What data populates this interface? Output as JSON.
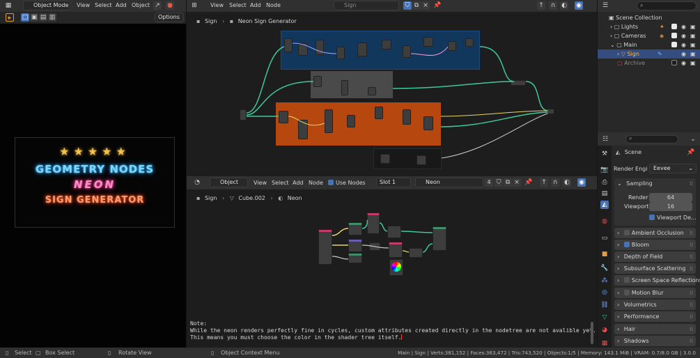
{
  "top_bar": {
    "mode": "Object Mode",
    "left_menus": [
      "View",
      "Select",
      "Add",
      "Object"
    ],
    "node_menus": [
      "View",
      "Select",
      "Add",
      "Node"
    ],
    "tree_name": "Sign"
  },
  "left_panel": {
    "options_label": "Options",
    "poster": {
      "stars": [
        "★",
        "★",
        "★",
        "★",
        "★"
      ],
      "line1": "GEOMETRY NODES",
      "line2": "NEON",
      "line3": "SIGN GENERATOR",
      "star_color": "#f2c14e",
      "line1_color": "#4fc9ff",
      "line2_color": "#ff5aa9",
      "line3_color": "#ff6a3a"
    }
  },
  "geo_editor": {
    "breadcrumb": [
      "Sign",
      "Neon Sign Generator"
    ],
    "frame_colors": {
      "blue": "#12375c",
      "grey": "#4a4a4a",
      "orange": "#b5470f",
      "dark": "#181818"
    }
  },
  "shader_editor": {
    "object_label": "Object",
    "menus": [
      "View",
      "Select",
      "Add",
      "Node"
    ],
    "use_nodes_label": "Use Nodes",
    "slot_label": "Slot 1",
    "material_name": "Neon",
    "user_count": "4",
    "breadcrumb": [
      "Sign",
      "Cube.002",
      "Neon"
    ]
  },
  "note": {
    "label": "Note:",
    "line1": "While the neon renders perfectly fine in cycles, custom attributes created directly in the nodetree are not avalible yet.",
    "line2": "This means you must choose the color in the shader tree itself."
  },
  "outliner": {
    "items": [
      {
        "label": "Scene Collection"
      },
      {
        "label": "Lights"
      },
      {
        "label": "Cameras"
      },
      {
        "label": "Main"
      },
      {
        "label": "Sign"
      },
      {
        "label": "Archive"
      }
    ]
  },
  "properties": {
    "scene_label": "Scene",
    "render_engine_label": "Render Engi",
    "render_engine_value": "Eevee",
    "sampling_label": "Sampling",
    "render_label": "Render",
    "render_value": "64",
    "viewport_label": "Viewport",
    "viewport_value": "16",
    "viewport_denoise_label": "Viewport De...",
    "panels": [
      {
        "label": "Ambient Occlusion",
        "checkbox": true,
        "checked": false
      },
      {
        "label": "Bloom",
        "checkbox": true,
        "checked": true
      },
      {
        "label": "Depth of Field",
        "checkbox": false,
        "checked": false
      },
      {
        "label": "Subsurface Scattering",
        "checkbox": false,
        "checked": false
      },
      {
        "label": "Screen Space Reflections",
        "checkbox": true,
        "checked": false
      },
      {
        "label": "Motion Blur",
        "checkbox": true,
        "checked": false
      },
      {
        "label": "Volumetrics",
        "checkbox": false,
        "checked": false
      },
      {
        "label": "Performance",
        "checkbox": false,
        "checked": false
      },
      {
        "label": "Hair",
        "checkbox": false,
        "checked": false
      },
      {
        "label": "Shadows",
        "checkbox": false,
        "checked": false
      }
    ]
  },
  "status_bar": {
    "select": "Select",
    "box_select": "Box Select",
    "rotate_view": "Rotate View",
    "context_menu": "Object Context Menu",
    "stats": "Main | Sign | Verts:381,152 | Faces:363,472 | Tris:743,520 | Objects:1/5 | Memory: 143.1 MiB | VRAM: 0.7/8.0 GB | 3.0.0"
  },
  "colors": {
    "accent": "#4772b3",
    "header": "#303030",
    "editor_bg": "#1d1d1d"
  }
}
